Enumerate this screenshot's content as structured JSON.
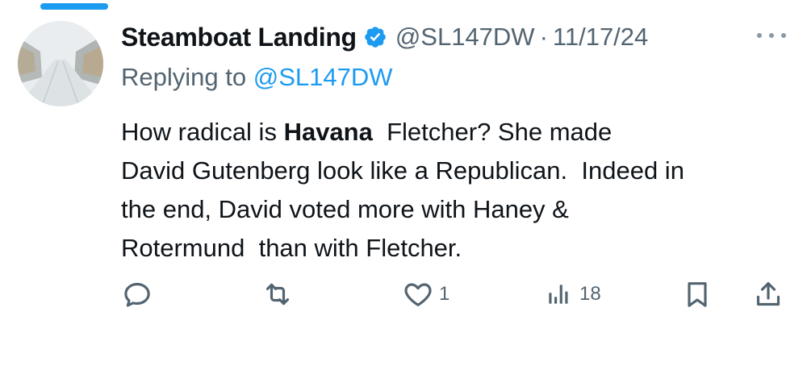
{
  "tweet": {
    "display_name": "Steamboat Landing",
    "handle": "@SL147DW",
    "separator": "·",
    "date": "11/17/24",
    "reply_prefix": "Replying to",
    "reply_mention": "@SL147DW",
    "body_lines": [
      {
        "before": "How radical is ",
        "bold": "Havana",
        "after": "  Fletcher? She made"
      },
      {
        "text": "David Gutenberg look like a Republican.  Indeed in"
      },
      {
        "text": "the end, David voted more with Haney &"
      },
      {
        "text": "Rotermund  than with Fletcher."
      }
    ],
    "actions": {
      "reply_count": "",
      "retweet_count": "",
      "like_count": "1",
      "views_count": "18"
    },
    "icons": {
      "verified": "verified-badge-icon",
      "more": "more-options-icon",
      "reply": "reply-icon",
      "retweet": "retweet-icon",
      "like": "heart-icon",
      "views": "views-icon",
      "bookmark": "bookmark-icon",
      "share": "share-icon"
    },
    "colors": {
      "accent": "#1d9bf0",
      "text": "#0f1419",
      "secondary": "#536471"
    }
  }
}
